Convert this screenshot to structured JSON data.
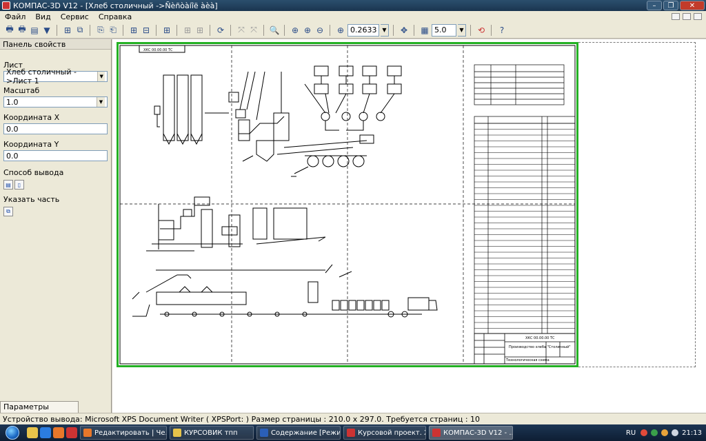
{
  "window": {
    "title": "КОМПАС-3D V12 - [Хлеб столичный ->Ñèñòàíîë àèà]"
  },
  "menu": [
    "Файл",
    "Вид",
    "Сервис",
    "Справка"
  ],
  "toolbar": {
    "zoom_value": "0.2633",
    "step_value": "5.0"
  },
  "panel": {
    "title": "Панель свойств",
    "sheet_label": "Лист",
    "sheet_value": "Хлеб столичный ->Лист 1",
    "scale_label": "Масштаб",
    "scale_value": "1.0",
    "coord_x_label": "Координата X",
    "coord_x_value": "0.0",
    "coord_y_label": "Координата Y",
    "coord_y_value": "0.0",
    "output_method_label": "Способ вывода",
    "specify_part_label": "Указать часть",
    "tab_label": "Параметры просмотра"
  },
  "statusbar": {
    "text": "Устройство вывода: Microsoft XPS Document Writer ( XPSPort: )  Размер страницы : 210.0 x 297.0.   Требуется страниц : 10"
  },
  "drawing": {
    "corner_stamp": "ХКС 00.00.00 ТС",
    "title_name": "Производство хлеба \"Столичный\"",
    "title_scheme": "Технологическая схема",
    "title_code": "ХКС 00.00.00 ТС"
  },
  "taskbar": {
    "tasks": [
      {
        "label": "Редактировать | Че...",
        "color": "#e8772a"
      },
      {
        "label": "КУРСОВИК тпп",
        "color": "#e7c34a"
      },
      {
        "label": "Содержание [Режи...",
        "color": "#2b5fb8"
      },
      {
        "label": "Курсовой проект. Х...",
        "color": "#c33"
      },
      {
        "label": "КОМПАС-3D V12 - ...",
        "color": "#c33"
      }
    ],
    "lang": "RU",
    "time": "21:13"
  }
}
